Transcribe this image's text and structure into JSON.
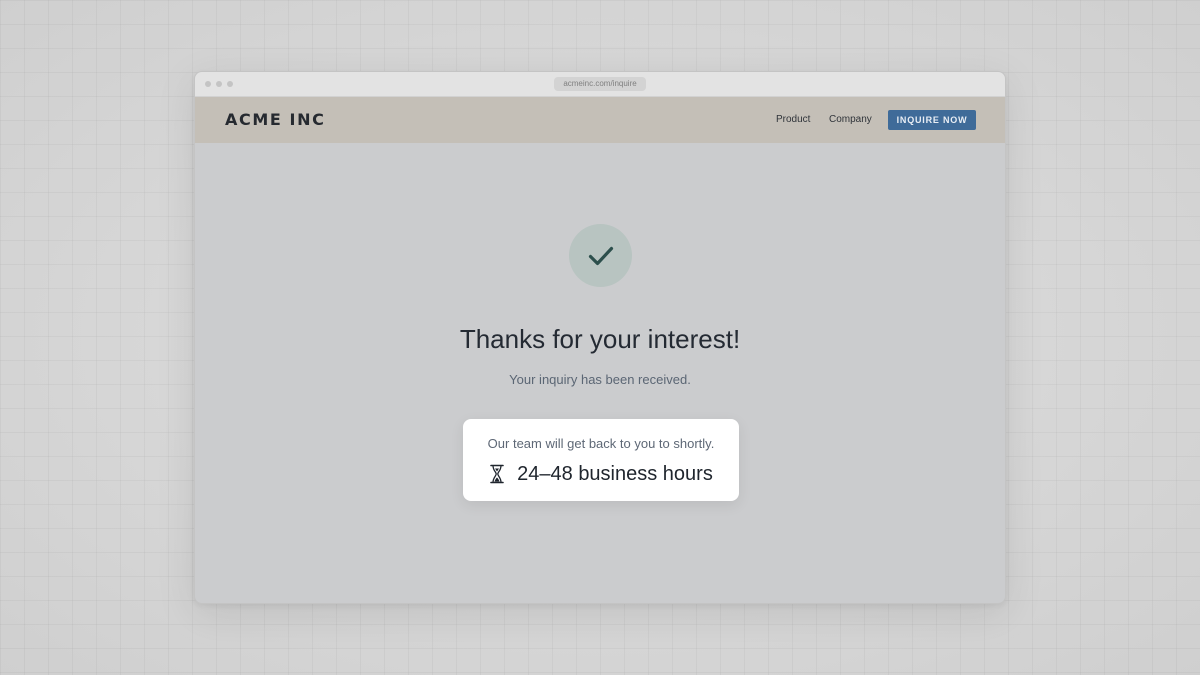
{
  "browser": {
    "url": "acmeinc.com/inquire"
  },
  "nav": {
    "logo": "ACME INC",
    "links": [
      {
        "label": "Product"
      },
      {
        "label": "Company"
      }
    ],
    "cta_label": "INQUIRE NOW"
  },
  "confirmation": {
    "icon": "checkmark-icon",
    "headline": "Thanks for your interest!",
    "subtext": "Your inquiry has been received."
  },
  "card": {
    "note": "Our team will get back to you to shortly.",
    "icon": "hourglass-icon",
    "response_time": "24–48 business hours"
  },
  "colors": {
    "accent": "#3f6b99",
    "nav_background": "#c4bfb7",
    "success_circle": "#b8c4c1",
    "check": "#2c4f4c"
  }
}
